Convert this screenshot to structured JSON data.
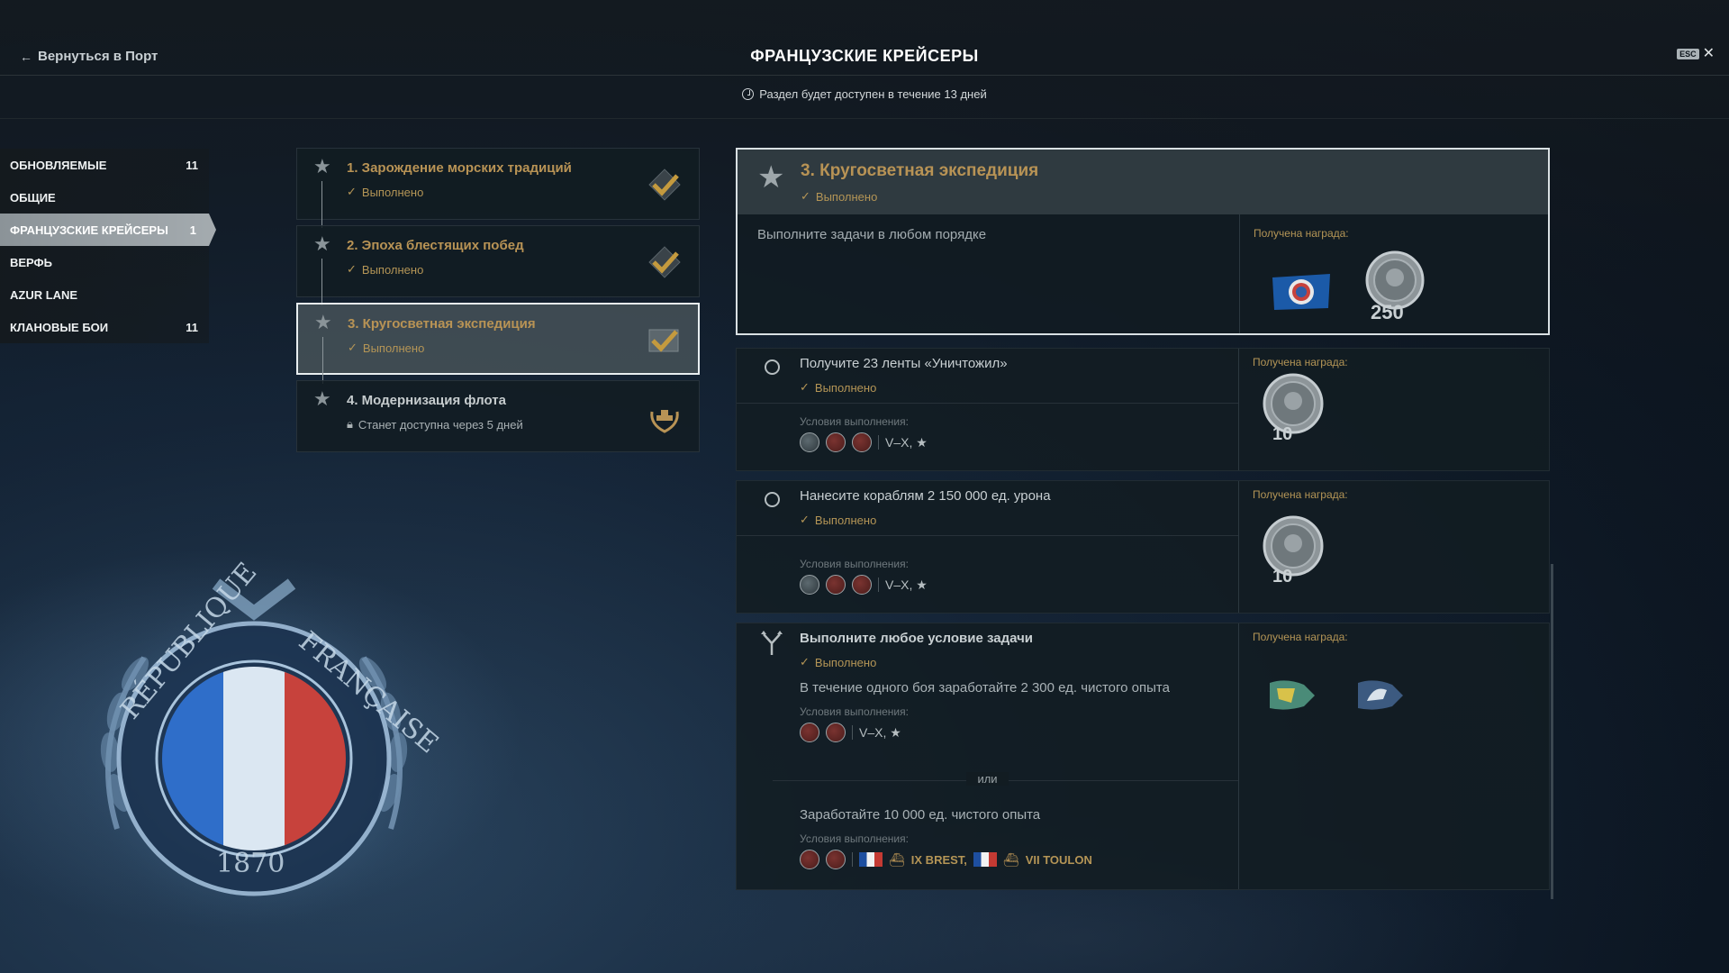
{
  "header": {
    "back_label": "Вернуться в Порт",
    "title": "ФРАНЦУЗСКИЕ КРЕЙСЕРЫ",
    "esc_label": "ESC",
    "availability": "Раздел будет доступен в течение 13 дней"
  },
  "sidebar": {
    "items": [
      {
        "label": "ОБНОВЛЯЕМЫЕ",
        "count": "11"
      },
      {
        "label": "ОБЩИЕ",
        "count": ""
      },
      {
        "label": "ФРАНЦУЗСКИЕ КРЕЙСЕРЫ",
        "count": "1"
      },
      {
        "label": "ВЕРФЬ",
        "count": ""
      },
      {
        "label": "AZUR LANE",
        "count": ""
      },
      {
        "label": "КЛАНОВЫЕ БОИ",
        "count": "11"
      }
    ]
  },
  "chapters": [
    {
      "title": "1. Зарождение морских традиций",
      "status": "Выполнено"
    },
    {
      "title": "2. Эпоха блестящих побед",
      "status": "Выполнено"
    },
    {
      "title": "3. Кругосветная экспедиция",
      "status": "Выполнено"
    },
    {
      "title": "4. Модернизация флота",
      "status": "Станет доступна через 5 дней"
    }
  ],
  "detail": {
    "title": "3. Кругосветная экспедиция",
    "status": "Выполнено",
    "description": "Выполните задачи в любом порядке",
    "reward_label": "Получена награда:",
    "coin_amount": "250",
    "tasks": [
      {
        "title": "Получите 23 ленты «Уничтожил»",
        "status": "Выполнено",
        "conditions_label": "Условия выполнения:",
        "tiers": "V–X, ★",
        "reward_label": "Получена награда:",
        "coin_amount": "10"
      },
      {
        "title": "Нанесите кораблям 2 150 000 ед. урона",
        "status": "Выполнено",
        "conditions_label": "Условия выполнения:",
        "tiers": "V–X, ★",
        "reward_label": "Получена награда:",
        "coin_amount": "10"
      },
      {
        "title": "Выполните любое условие задачи",
        "status": "Выполнено",
        "option1": "В течение одного боя заработайте 2 300 ед. чистого опыта",
        "conditions_label": "Условия выполнения:",
        "tiers": "V–X, ★",
        "or_label": "или",
        "option2": "Заработайте 10 000 ед. чистого опыта",
        "conditions_label2": "Условия выполнения:",
        "ship1": "IX BREST,",
        "ship2": "VII TOULON",
        "reward_label": "Получена награда:"
      }
    ]
  },
  "colors": {
    "gold": "#b89355",
    "status_gold": "#b49556",
    "active_tab": "#a4abaf"
  }
}
